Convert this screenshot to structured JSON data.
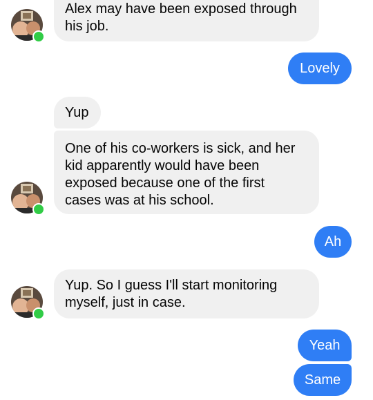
{
  "conversation": {
    "messages": [
      {
        "sender": "contact",
        "text": "Alex may have been exposed through\nhis job."
      },
      {
        "sender": "me",
        "text": "Lovely"
      },
      {
        "sender": "contact",
        "text": "Yup"
      },
      {
        "sender": "contact",
        "text": "One of his co-workers is sick, and her\nkid apparently would have been\nexposed because one of the first\ncases was at his school."
      },
      {
        "sender": "me",
        "text": "Ah"
      },
      {
        "sender": "contact",
        "text": "Yup.  So I guess I'll start monitoring\nmyself, just in case."
      },
      {
        "sender": "me",
        "text": "Yeah"
      },
      {
        "sender": "me",
        "text": "Same"
      }
    ]
  },
  "colors": {
    "incoming_bubble": "#f0f0f0",
    "outgoing_bubble": "#2f7ef5",
    "online_indicator": "#31cc46"
  },
  "icons": {
    "avatar": "contact-avatar-photo",
    "presence": "online-status-dot"
  }
}
